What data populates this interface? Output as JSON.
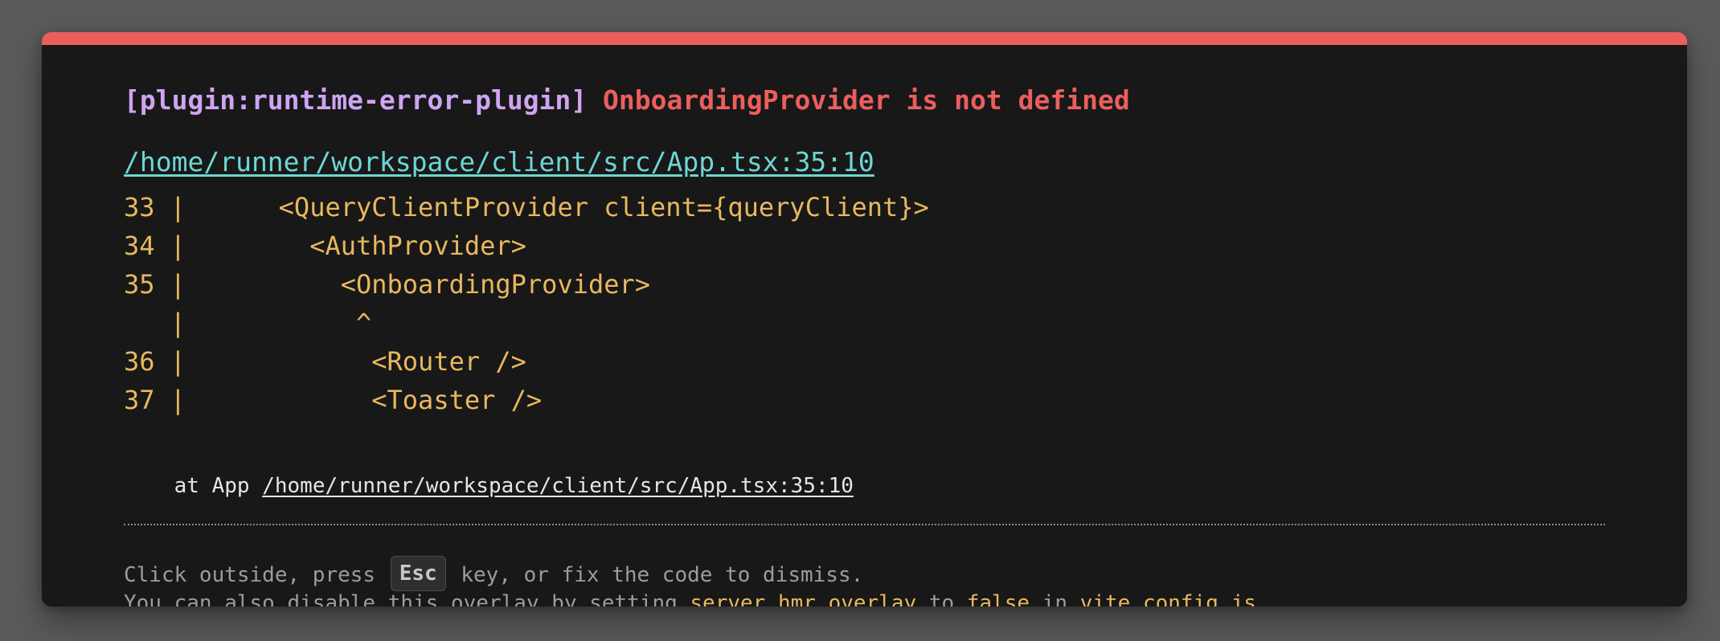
{
  "error": {
    "plugin": "[plugin:runtime-error-plugin]",
    "message": "OnboardingProvider is not defined",
    "file": "/home/runner/workspace/client/src/App.tsx:35:10",
    "frame_lines": [
      "33 |      <QueryClientProvider client={queryClient}>",
      "34 |        <AuthProvider>",
      "35 |          <OnboardingProvider>",
      "   |           ^",
      "36 |            <Router />",
      "37 |            <Toaster />"
    ],
    "stack": {
      "prefix": "at App ",
      "file": "/home/runner/workspace/client/src/App.tsx:35:10"
    }
  },
  "tip": {
    "line1_before": "Click outside, press ",
    "key": "Esc",
    "line1_after": " key, or fix the code to dismiss.",
    "line2_part1": "You can also disable this overlay by setting ",
    "setting": "server.hmr.overlay",
    "line2_part2": " to ",
    "value": "false",
    "line2_part3": " in ",
    "config_file": "vite.config.js",
    "line2_part4": "."
  },
  "colors": {
    "accent_bar": "#ec5e5e",
    "plugin": "#cfa4f2",
    "message": "#ec5e5e",
    "link": "#6ed6d2",
    "code": "#e8b85e",
    "background": "#181818"
  }
}
